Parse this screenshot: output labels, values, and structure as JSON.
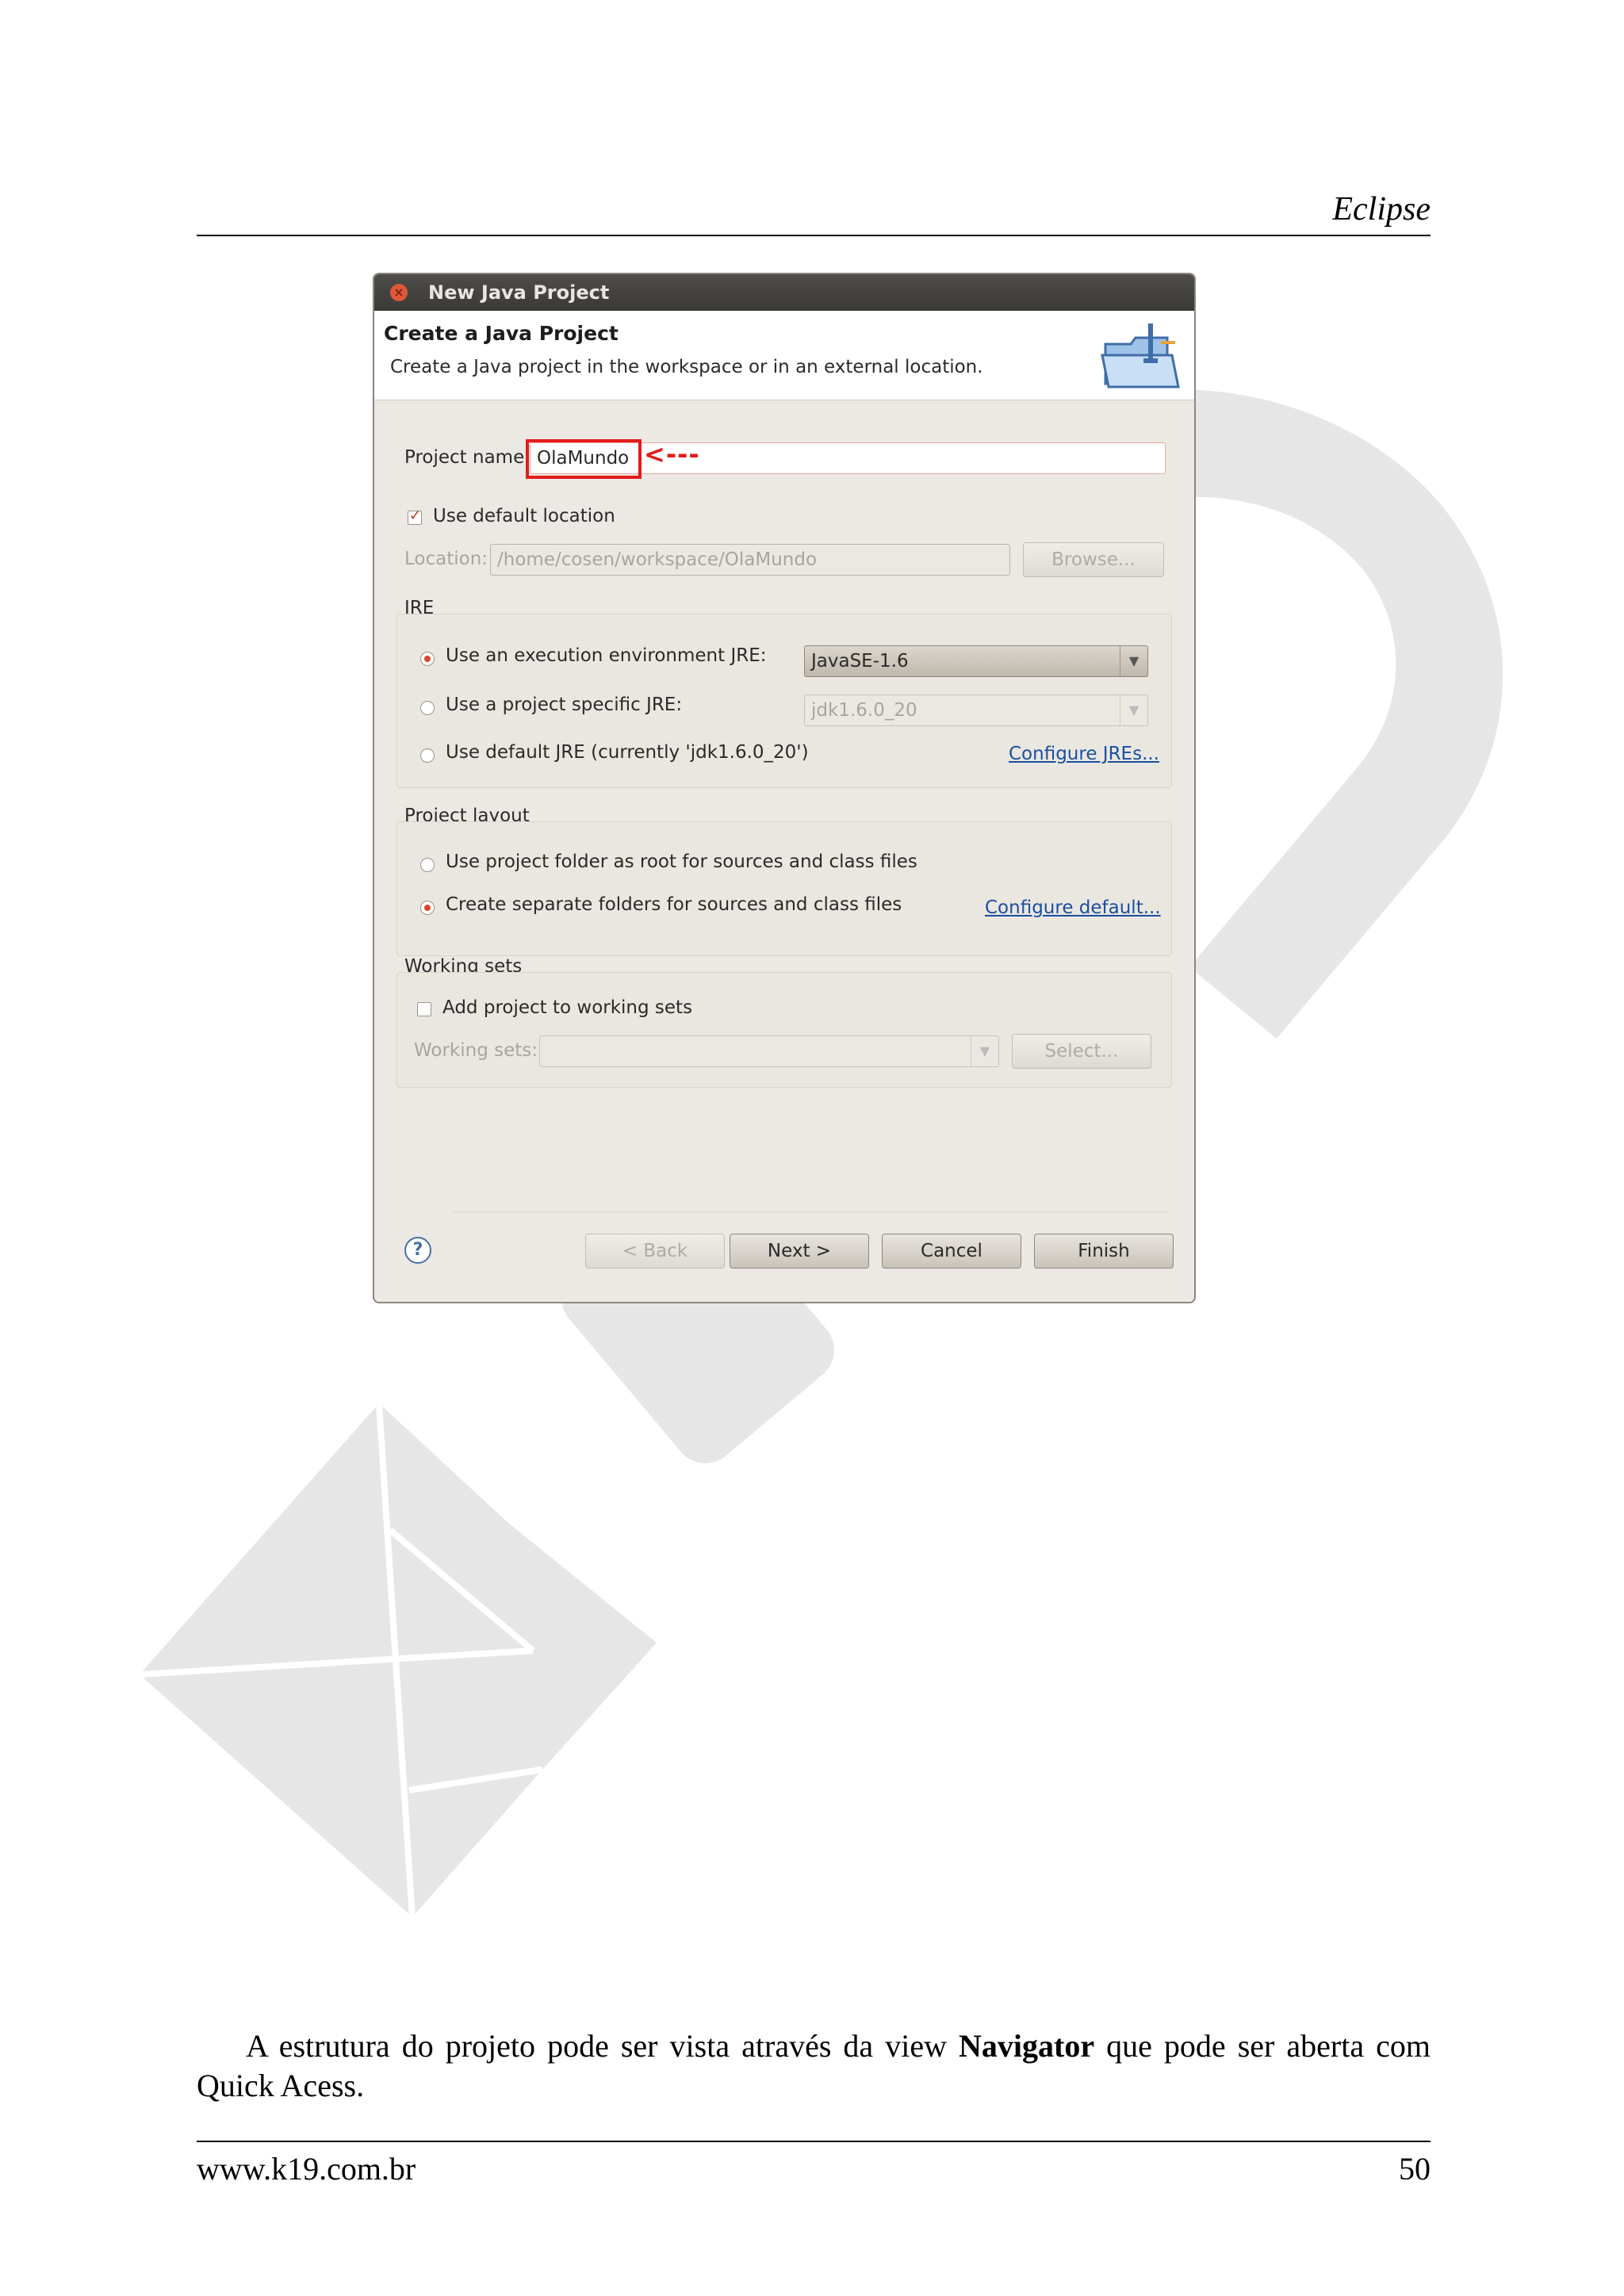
{
  "running_head": "Eclipse",
  "dialog": {
    "window_title": "New Java Project",
    "header_title": "Create a Java Project",
    "header_description": "Create a Java project in the workspace or in an external location.",
    "project_name_label": "Project name:",
    "project_name_value": "OlaMundo",
    "use_default_location_label": "Use default location",
    "location_label": "Location:",
    "location_value": "/home/cosen/workspace/OlaMundo",
    "browse_label": "Browse...",
    "jre": {
      "group_label": "JRE",
      "exec_env_label": "Use an execution environment JRE:",
      "exec_env_value": "JavaSE-1.6",
      "project_specific_label": "Use a project specific JRE:",
      "project_specific_value": "jdk1.6.0_20",
      "default_jre_label": "Use default JRE (currently 'jdk1.6.0_20')",
      "configure_link": "Configure JREs..."
    },
    "layout": {
      "group_label": "Project layout",
      "root_label": "Use project folder as root for sources and class files",
      "separate_label": "Create separate folders for sources and class files",
      "configure_link": "Configure default..."
    },
    "working_sets": {
      "group_label": "Working sets",
      "add_label": "Add project to working sets",
      "sets_label": "Working sets:",
      "select_label": "Select..."
    },
    "buttons": {
      "back": "< Back",
      "next": "Next >",
      "cancel": "Cancel",
      "finish": "Finish"
    },
    "help_symbol": "?",
    "annotation_arrow": "<---",
    "colors": {
      "accent": "#e31b1b",
      "radio_on": "#d8482a",
      "link": "#1a4fa0"
    }
  },
  "body": {
    "text_before": "A estrutura do projeto pode ser vista através da view ",
    "text_bold": "Navigator",
    "text_after": " que pode ser aberta com Quick Acess."
  },
  "footer": {
    "url": "www.k19.com.br",
    "page_number": "50"
  }
}
